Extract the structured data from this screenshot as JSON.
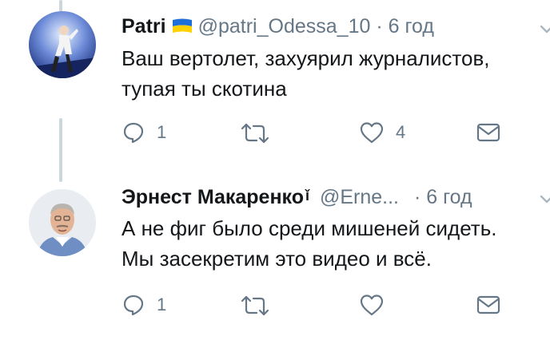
{
  "tweets": [
    {
      "name": "Patri",
      "flag": "ukraine-flag",
      "handle": "@patri_Odessa_10",
      "separator": "·",
      "time": "6 год",
      "lines": [
        "Ваш вертолет, захуярил журналистов,",
        "тупая ты скотина"
      ],
      "reply_count": "1",
      "retweet_count": "",
      "like_count": "4"
    },
    {
      "name": "Эрнест Макаренко",
      "name_suffix": "ǐ",
      "handle": "@Erne...",
      "separator": "·",
      "time": "6 год",
      "lines": [
        "А не фиг было среди мишеней сидеть.",
        "Мы засекретим это видео и всё."
      ],
      "reply_count": "1",
      "retweet_count": "",
      "like_count": ""
    }
  ],
  "colors": {
    "secondary": "#657786",
    "thread": "#ccd6dd",
    "text": "#14171a"
  }
}
